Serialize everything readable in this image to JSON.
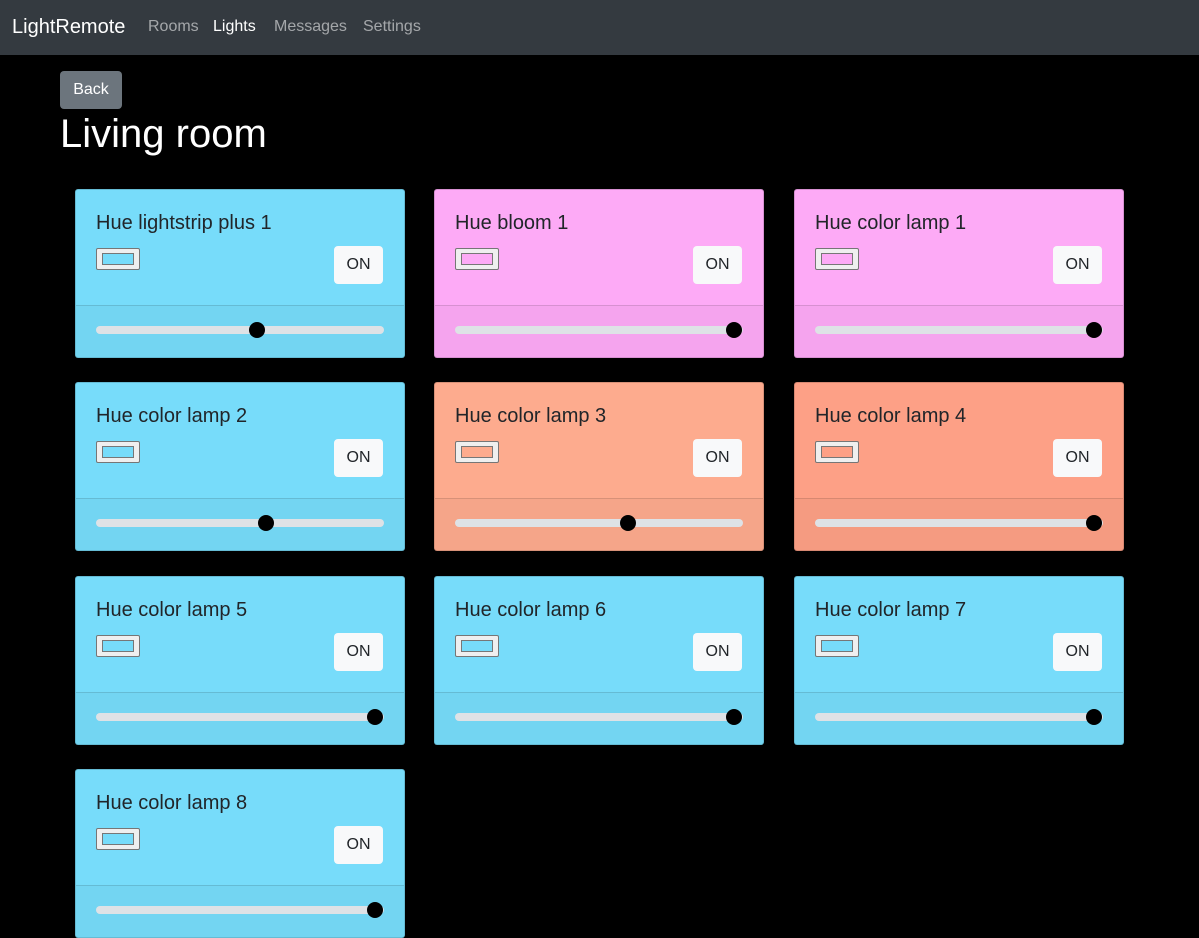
{
  "navbar": {
    "brand": "LightRemote",
    "items": [
      {
        "label": "Rooms",
        "active": false
      },
      {
        "label": "Lights",
        "active": true
      },
      {
        "label": "Messages",
        "active": false
      },
      {
        "label": "Settings",
        "active": false
      }
    ]
  },
  "back_label": "Back",
  "page_title": "Living room",
  "lights": [
    {
      "name": "Hue lightstrip plus 1",
      "color": "#77dcfa",
      "button": "ON",
      "brightness": 0.56
    },
    {
      "name": "Hue bloom 1",
      "color": "#fdaaf6",
      "button": "ON",
      "brightness": 0.97
    },
    {
      "name": "Hue color lamp 1",
      "color": "#fdaaf6",
      "button": "ON",
      "brightness": 0.97
    },
    {
      "name": "Hue color lamp 2",
      "color": "#77dcfa",
      "button": "ON",
      "brightness": 0.59
    },
    {
      "name": "Hue color lamp 3",
      "color": "#fdab8e",
      "button": "ON",
      "brightness": 0.6
    },
    {
      "name": "Hue color lamp 4",
      "color": "#fda086",
      "button": "ON",
      "brightness": 0.97
    },
    {
      "name": "Hue color lamp 5",
      "color": "#77dcfa",
      "button": "ON",
      "brightness": 0.97
    },
    {
      "name": "Hue color lamp 6",
      "color": "#77dcfa",
      "button": "ON",
      "brightness": 0.97
    },
    {
      "name": "Hue color lamp 7",
      "color": "#77dcfa",
      "button": "ON",
      "brightness": 0.97
    },
    {
      "name": "Hue color lamp 8",
      "color": "#77dcfa",
      "button": "ON",
      "brightness": 0.97
    }
  ]
}
